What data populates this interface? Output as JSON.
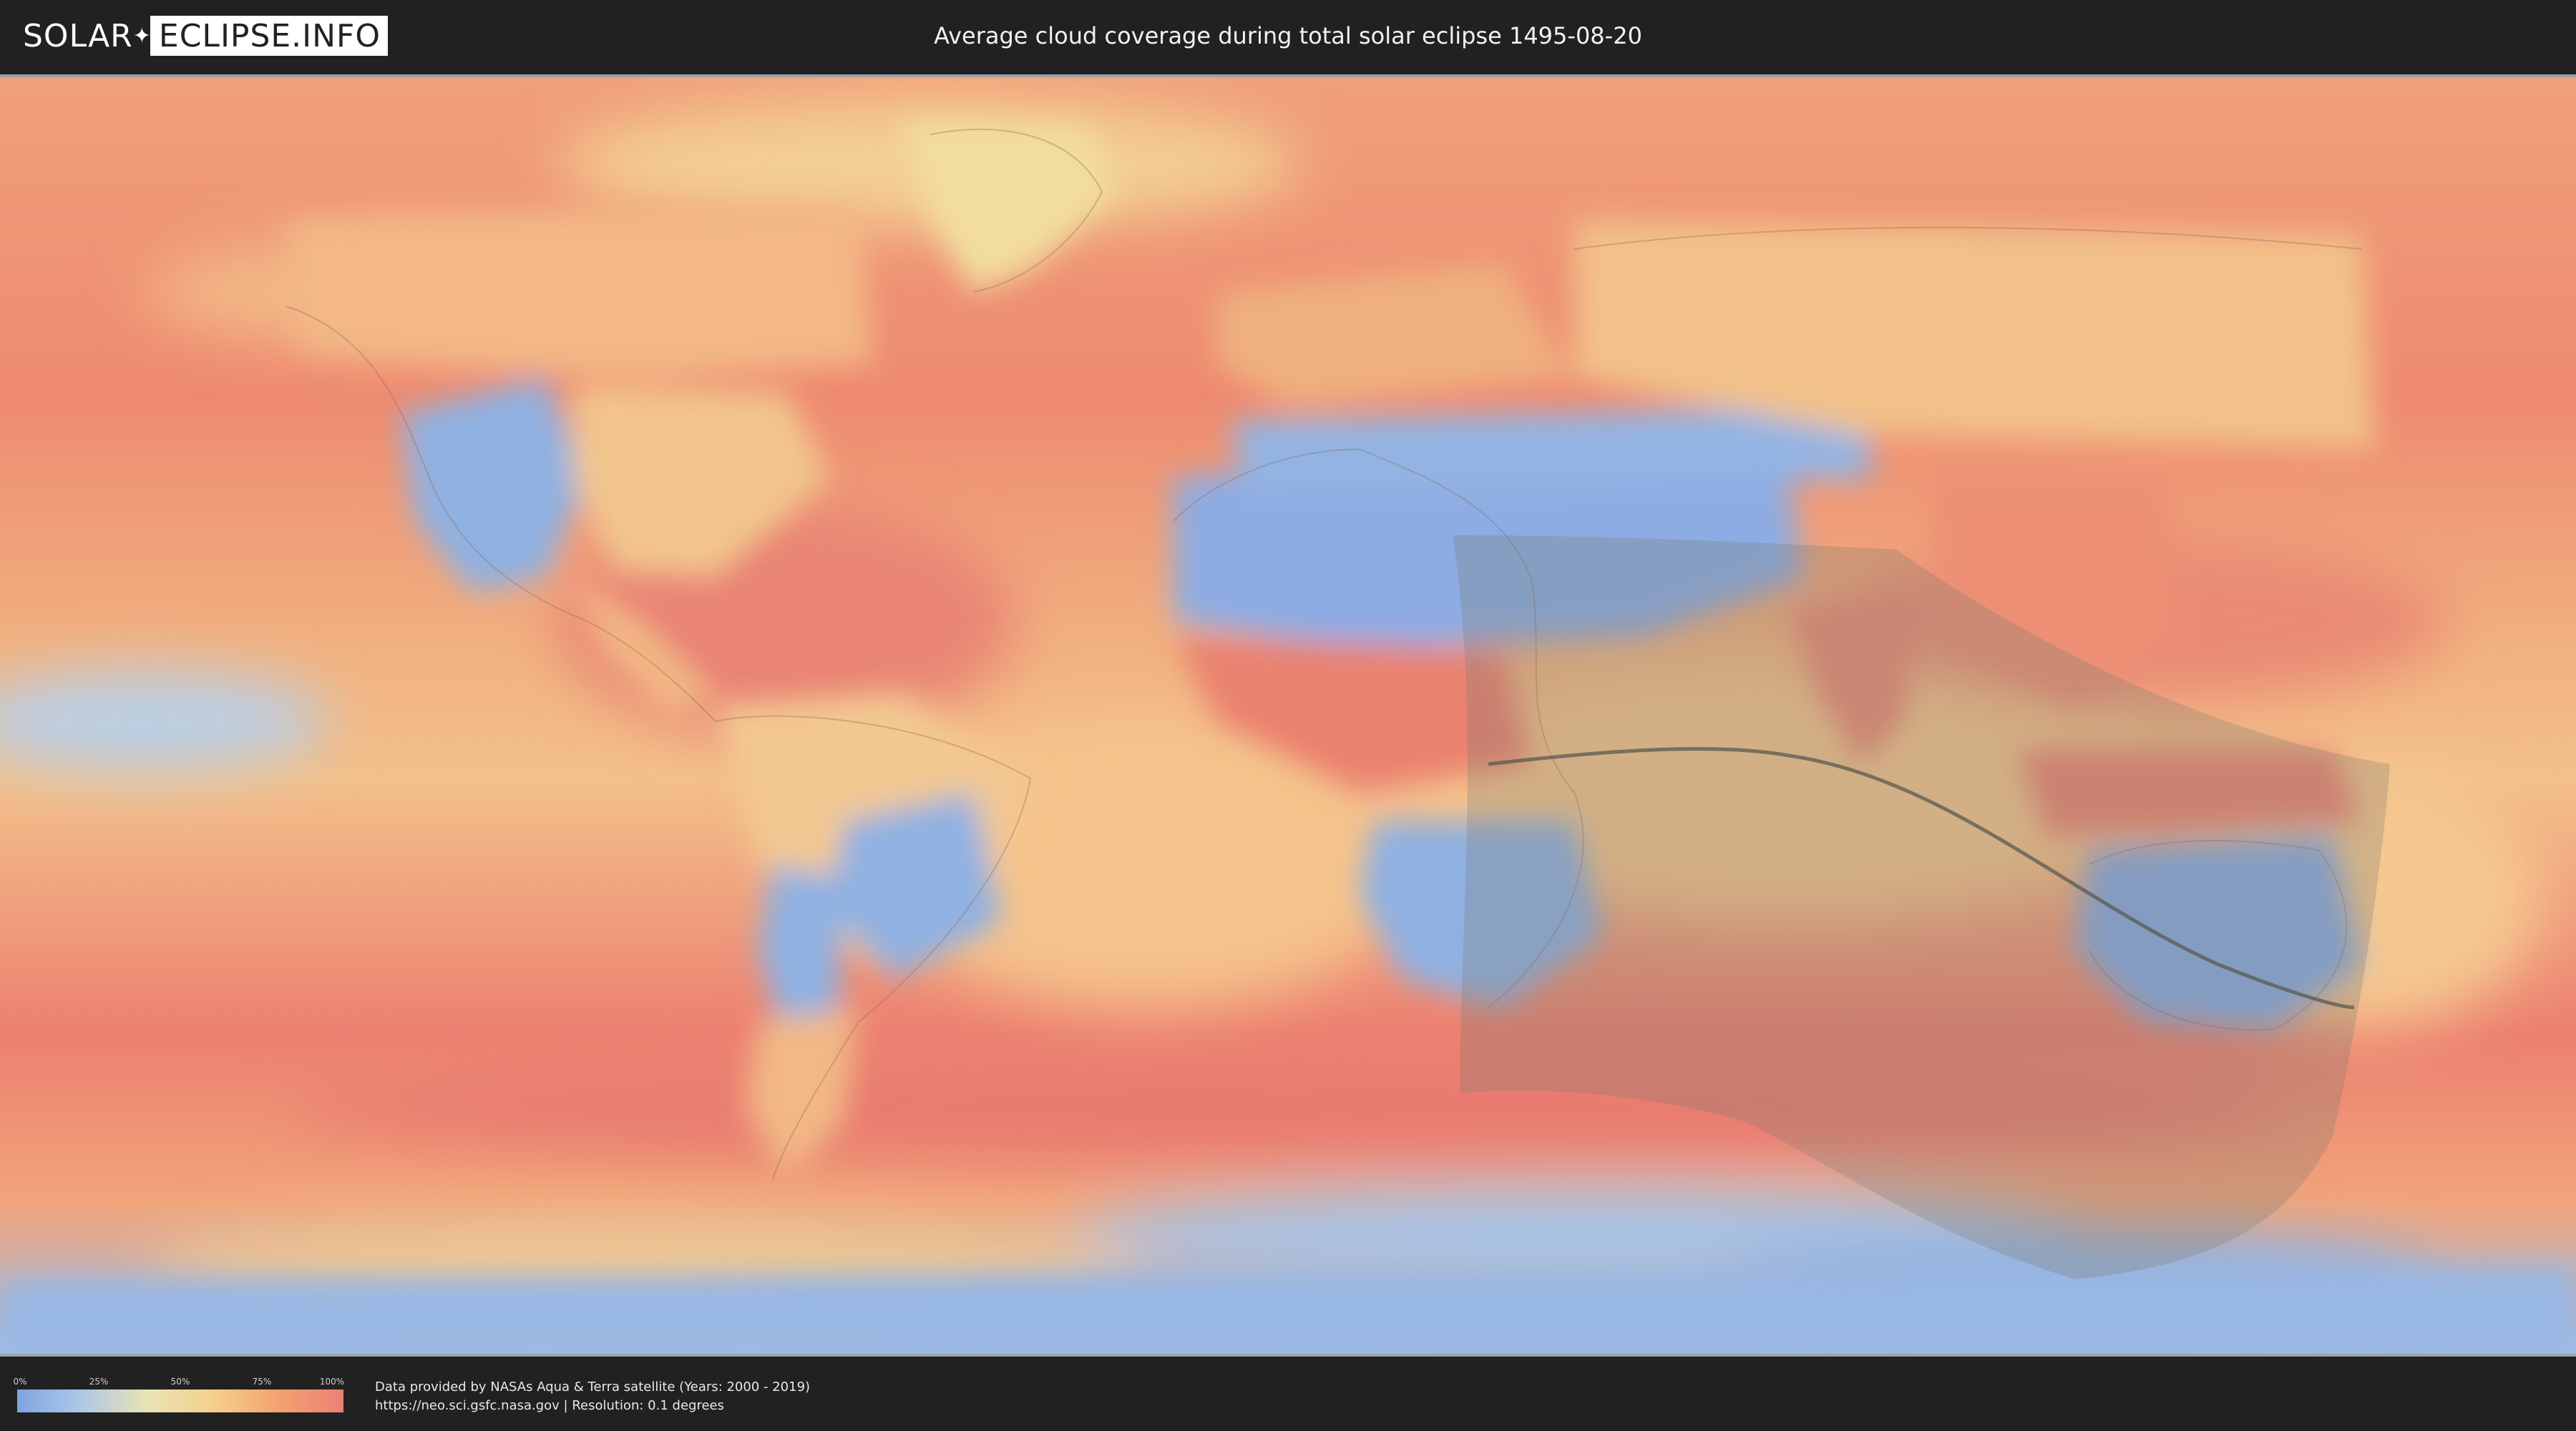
{
  "header": {
    "logo_part1": "SOLAR",
    "logo_part2": "ECLIPSE.INFO",
    "title": "Average cloud coverage during total solar eclipse 1495-08-20"
  },
  "legend": {
    "ticks": [
      "0%",
      "25%",
      "50%",
      "75%",
      "100%"
    ],
    "colors": [
      "#7ea3df",
      "#a9c6e8",
      "#e7e4b4",
      "#f6cf8d",
      "#f3a26f",
      "#ec7f77"
    ]
  },
  "footer": {
    "credit_line1": "Data provided by NASAs Aqua & Terra satellite (Years: 2000 - 2019)",
    "credit_line2": "https://neo.sci.gsfc.nasa.gov | Resolution: 0.1 degrees"
  },
  "map": {
    "projection": "equirectangular",
    "layer": "cloud coverage",
    "eclipse_shadow_color": "#7a7a70",
    "central_line_color": "#5a5a50"
  }
}
